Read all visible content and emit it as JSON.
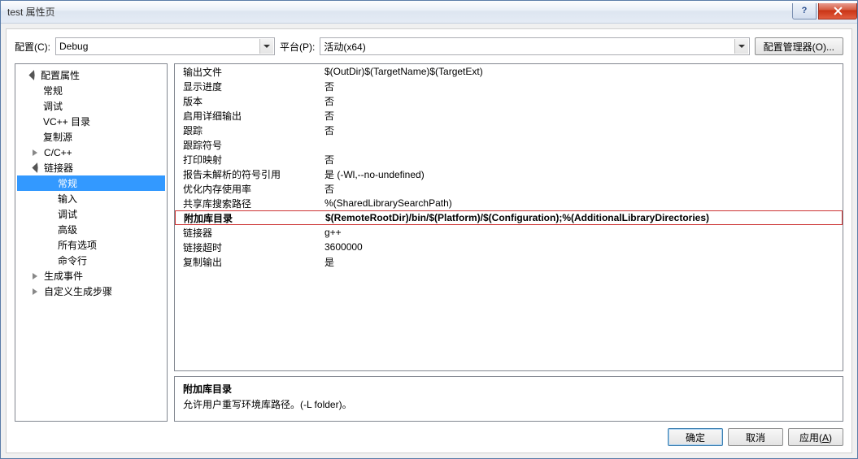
{
  "title": "test 属性页",
  "toolbar": {
    "config_label": "配置(C):",
    "config_value": "Debug",
    "platform_label": "平台(P):",
    "platform_value": "活动(x64)",
    "config_mgr": "配置管理器(O)..."
  },
  "tree": {
    "root": "配置属性",
    "items": [
      "常规",
      "调试",
      "VC++ 目录",
      "复制源"
    ],
    "cpp": "C/C++",
    "linker": "链接器",
    "linker_items": [
      "常规",
      "输入",
      "调试",
      "高级",
      "所有选项",
      "命令行"
    ],
    "build_events": "生成事件",
    "custom_step": "自定义生成步骤"
  },
  "grid": [
    {
      "k": "输出文件",
      "v": "$(OutDir)$(TargetName)$(TargetExt)"
    },
    {
      "k": "显示进度",
      "v": "否"
    },
    {
      "k": "版本",
      "v": "否"
    },
    {
      "k": "启用详细输出",
      "v": "否"
    },
    {
      "k": "跟踪",
      "v": "否"
    },
    {
      "k": "跟踪符号",
      "v": ""
    },
    {
      "k": "打印映射",
      "v": "否"
    },
    {
      "k": "报告未解析的符号引用",
      "v": "是 (-Wl,--no-undefined)"
    },
    {
      "k": "优化内存使用率",
      "v": "否"
    },
    {
      "k": "共享库搜索路径",
      "v": "%(SharedLibrarySearchPath)"
    },
    {
      "k": "附加库目录",
      "v": "$(RemoteRootDir)/bin/$(Platform)/$(Configuration);%(AdditionalLibraryDirectories)",
      "hl": true
    },
    {
      "k": "链接器",
      "v": "g++"
    },
    {
      "k": "链接超时",
      "v": "3600000"
    },
    {
      "k": "复制输出",
      "v": "是"
    }
  ],
  "desc": {
    "title": "附加库目录",
    "text": "允许用户重写环境库路径。(-L folder)。"
  },
  "buttons": {
    "ok": "确定",
    "cancel": "取消",
    "apply": "应用(A)"
  },
  "apply_letter": "A"
}
